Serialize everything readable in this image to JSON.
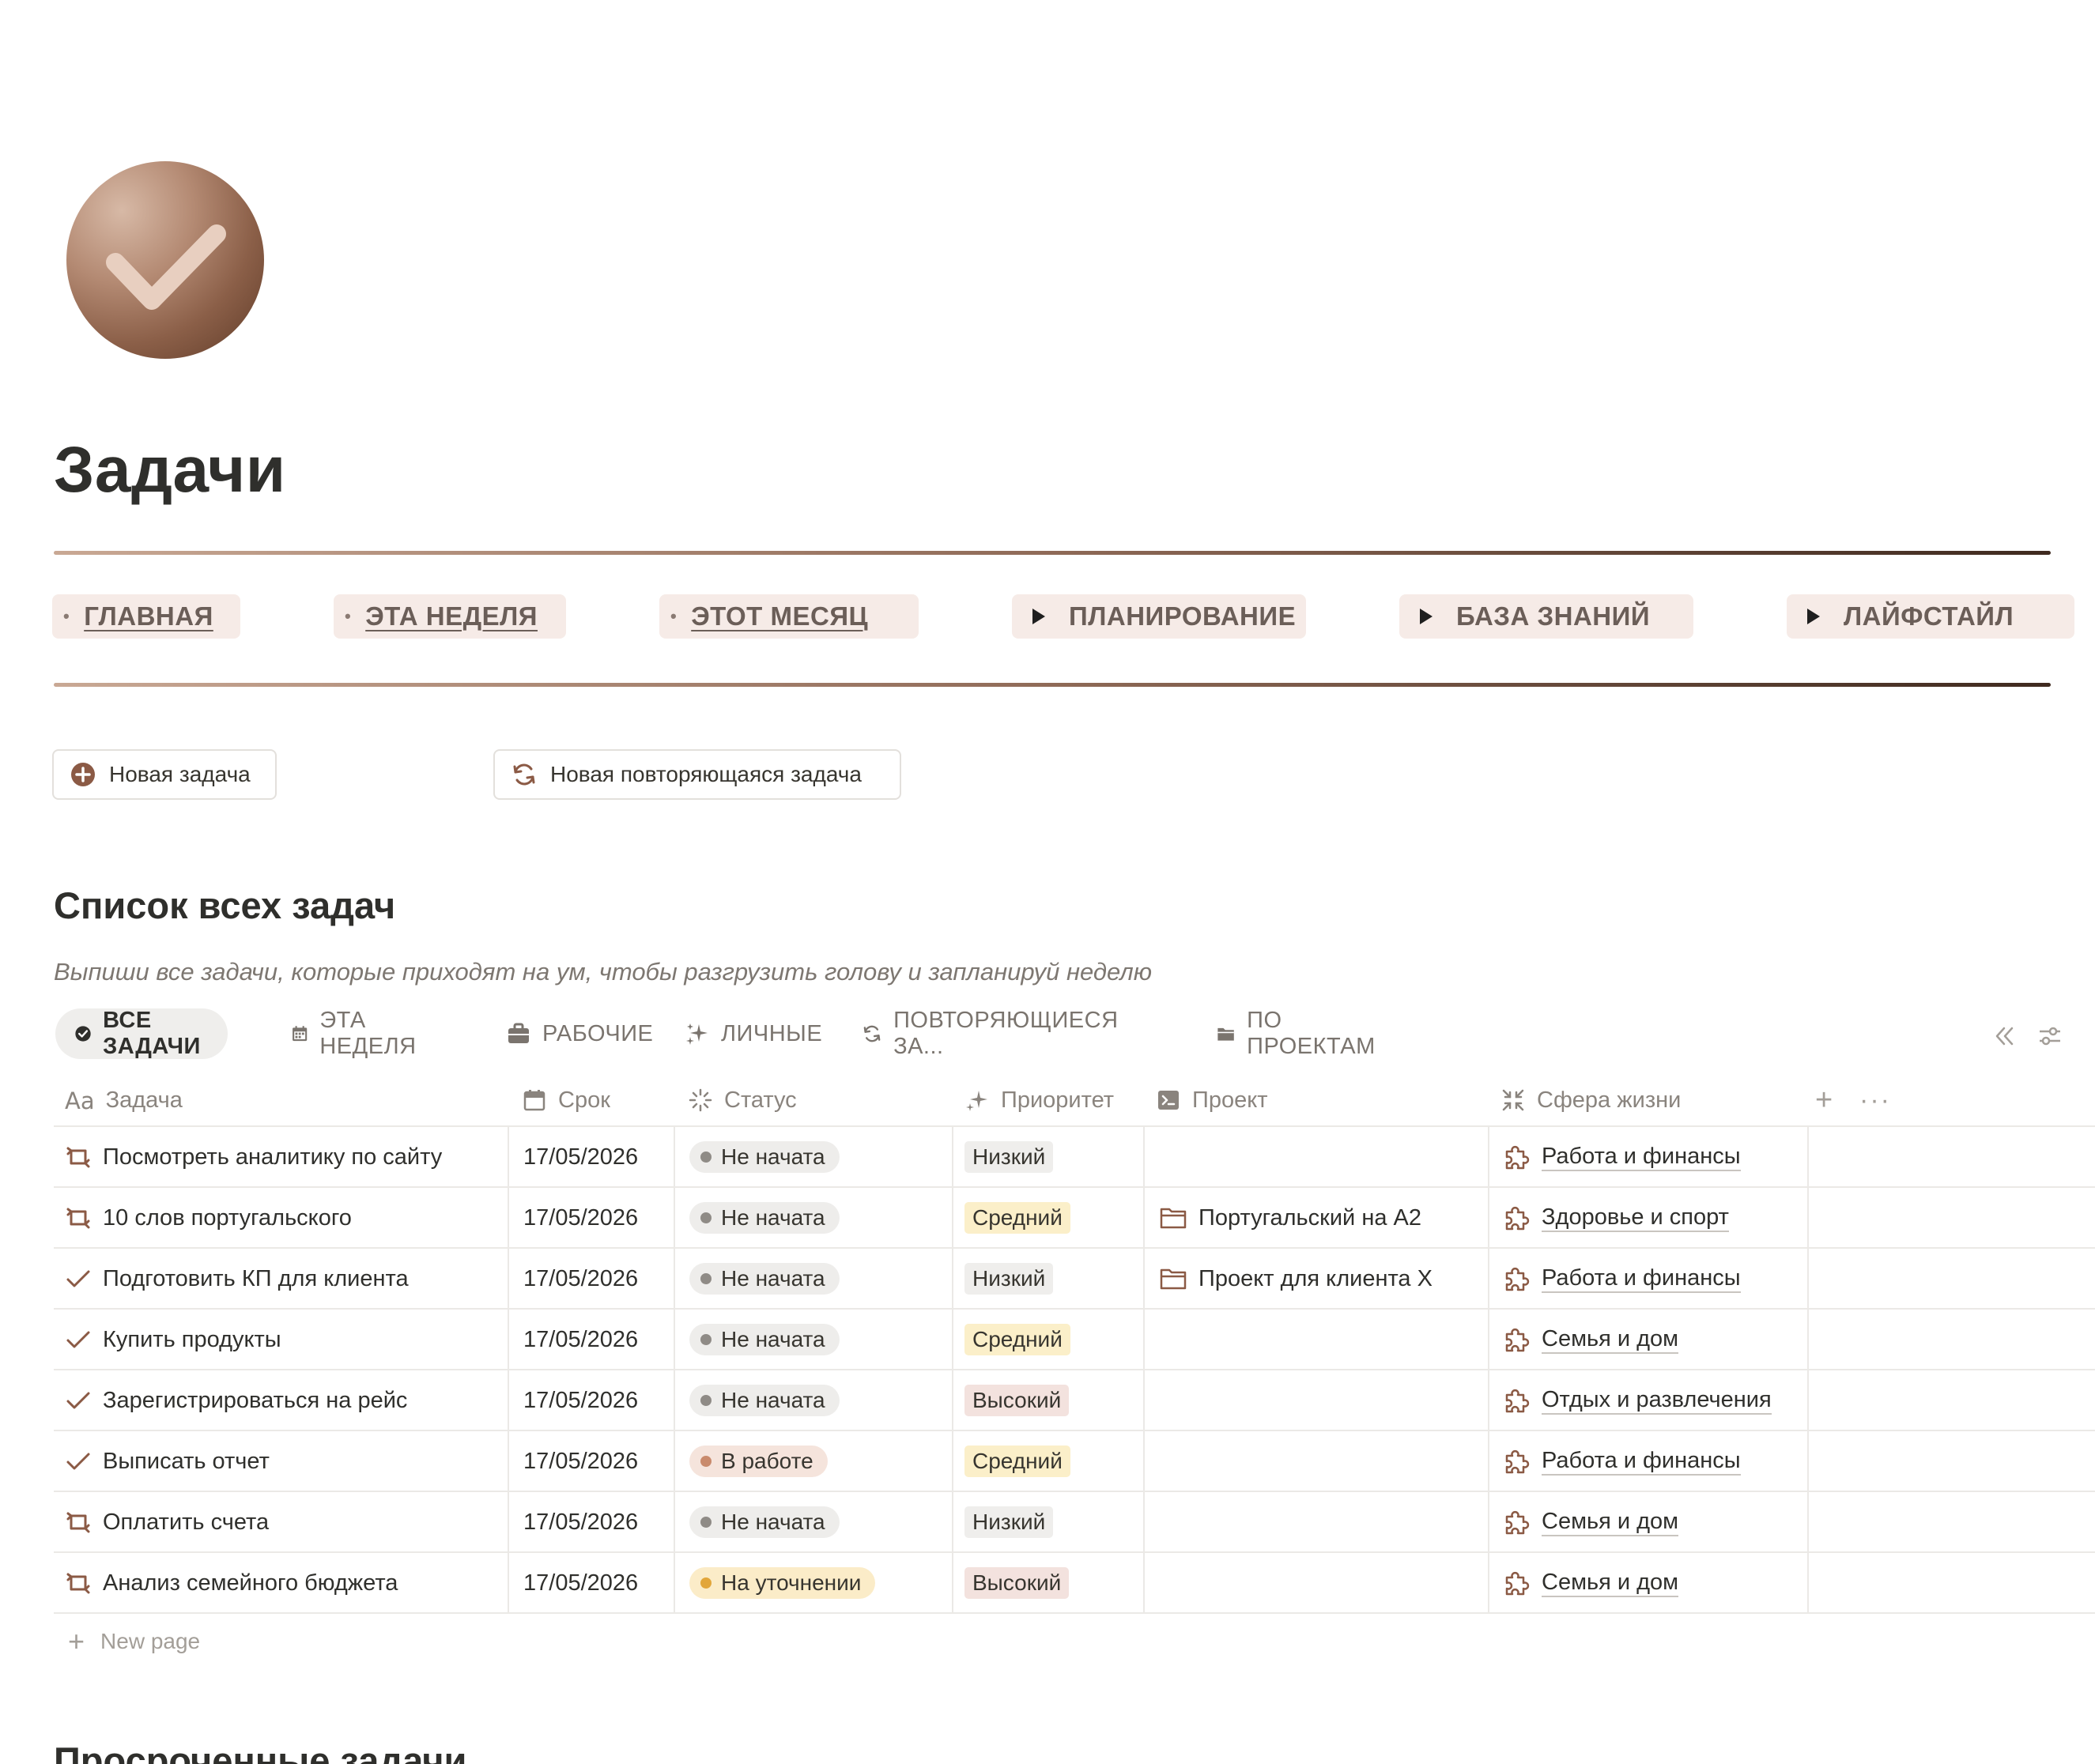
{
  "page": {
    "title": "Задачи"
  },
  "nav": [
    {
      "label": "ГЛАВНАЯ",
      "kind": "link"
    },
    {
      "label": "ЭТА НЕДЕЛЯ",
      "kind": "link"
    },
    {
      "label": "ЭТОТ МЕСЯЦ",
      "kind": "link"
    },
    {
      "label": "ПЛАНИРОВАНИЕ",
      "kind": "toggle"
    },
    {
      "label": "БАЗА ЗНАНИЙ",
      "kind": "toggle"
    },
    {
      "label": "ЛАЙФСТАЙЛ",
      "kind": "toggle"
    }
  ],
  "actions": {
    "new_task": "Новая задача",
    "new_recurring_task": "Новая повторяющаяся задача"
  },
  "section_all": {
    "title": "Список всех задач",
    "description": "Выпиши все задачи, которые приходят на ум, чтобы разгрузить голову и запланируй неделю"
  },
  "tabs": [
    {
      "label": "ВСЕ ЗАДАЧИ",
      "icon": "check-circle-icon",
      "active": true
    },
    {
      "label": "ЭТА НЕДЕЛЯ",
      "icon": "calendar-icon"
    },
    {
      "label": "РАБОЧИЕ",
      "icon": "briefcase-icon"
    },
    {
      "label": "ЛИЧНЫЕ",
      "icon": "sparkle-icon"
    },
    {
      "label": "ПОВТОРЯЮЩИЕСЯ ЗА...",
      "icon": "repeat-icon"
    },
    {
      "label": "ПО ПРОЕКТАМ",
      "icon": "folder-icon"
    }
  ],
  "columns": {
    "task": "Задача",
    "due": "Срок",
    "status": "Статус",
    "priority": "Приоритет",
    "project": "Проект",
    "sphere": "Сфера жизни"
  },
  "rows": [
    {
      "task": "Посмотреть аналитику по сайту",
      "type": "recurring",
      "due": "17/05/2026",
      "status": "Не начата",
      "priority": "Низкий",
      "project": "",
      "sphere": "Работа и финансы"
    },
    {
      "task": "10 слов португальского",
      "type": "recurring",
      "due": "17/05/2026",
      "status": "Не начата",
      "priority": "Средний",
      "project": "Португальский на A2",
      "sphere": "Здоровье и спорт"
    },
    {
      "task": "Подготовить КП для клиента",
      "type": "single",
      "due": "17/05/2026",
      "status": "Не начата",
      "priority": "Низкий",
      "project": "Проект для клиента X",
      "sphere": "Работа и финансы"
    },
    {
      "task": "Купить продукты",
      "type": "single",
      "due": "17/05/2026",
      "status": "Не начата",
      "priority": "Средний",
      "project": "",
      "sphere": "Семья и дом"
    },
    {
      "task": "Зарегистрироваться на рейс",
      "type": "single",
      "due": "17/05/2026",
      "status": "Не начата",
      "priority": "Высокий",
      "project": "",
      "sphere": "Отдых и развлечения"
    },
    {
      "task": "Выписать отчет",
      "type": "single",
      "due": "17/05/2026",
      "status": "В работе",
      "priority": "Средний",
      "project": "",
      "sphere": "Работа и финансы"
    },
    {
      "task": "Оплатить счета",
      "type": "recurring",
      "due": "17/05/2026",
      "status": "Не начата",
      "priority": "Низкий",
      "project": "",
      "sphere": "Семья и дом"
    },
    {
      "task": "Анализ семейного бюджета",
      "type": "recurring",
      "due": "17/05/2026",
      "status": "На уточнении",
      "priority": "Высокий",
      "project": "",
      "sphere": "Семья и дом"
    }
  ],
  "status_colors": {
    "Не начата": {
      "bg": "#eeedeb",
      "dot": "#8f8b86"
    },
    "В работе": {
      "bg": "#f5e4dc",
      "dot": "#c98a6c"
    },
    "На уточнении": {
      "bg": "#fbecc8",
      "dot": "#e2a63a"
    }
  },
  "priority_colors": {
    "Низкий": "#efeeec",
    "Средний": "#fbefc9",
    "Высокий": "#f3e2de"
  },
  "accent_color": "#8b5a45",
  "new_page_label": "New page",
  "section_overdue": {
    "title": "Просроченные задачи"
  }
}
